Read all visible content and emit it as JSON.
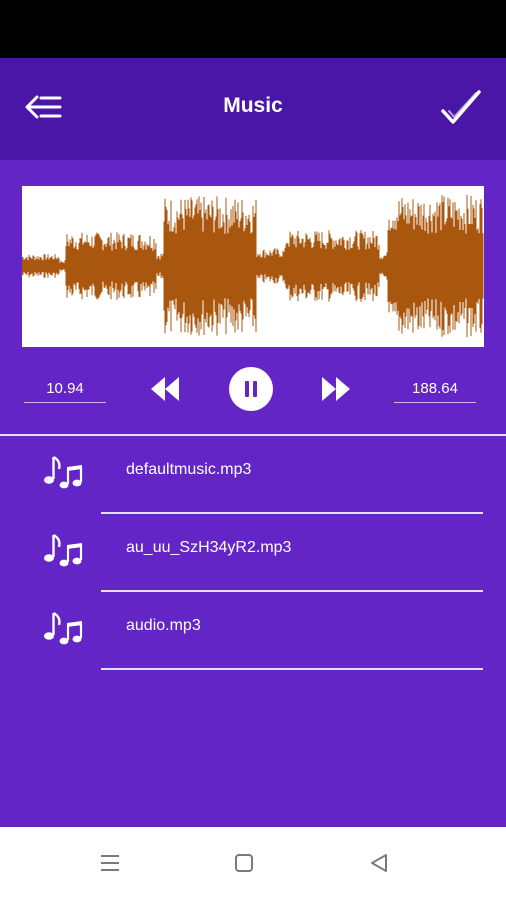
{
  "app_bar": {
    "title": "Music",
    "back_icon": "back-menu-icon",
    "confirm_icon": "check-icon"
  },
  "player": {
    "start_time": "10.94",
    "end_time": "188.64",
    "state": "playing",
    "controls": [
      "rewind-icon",
      "pause-icon",
      "fast-forward-icon"
    ],
    "waveform_color": "#a9560f"
  },
  "tracks": [
    {
      "name": "defaultmusic.mp3",
      "icon": "music-notes-icon"
    },
    {
      "name": "au_uu_SzH34yR2.mp3",
      "icon": "music-notes-icon"
    },
    {
      "name": "audio.mp3",
      "icon": "music-notes-icon"
    }
  ],
  "system_nav": {
    "buttons": [
      "recents-icon",
      "home-icon",
      "back-icon"
    ]
  },
  "colors": {
    "app_bar": "#4a16a8",
    "content_bg": "#6325c6",
    "status_bar": "#000000"
  }
}
